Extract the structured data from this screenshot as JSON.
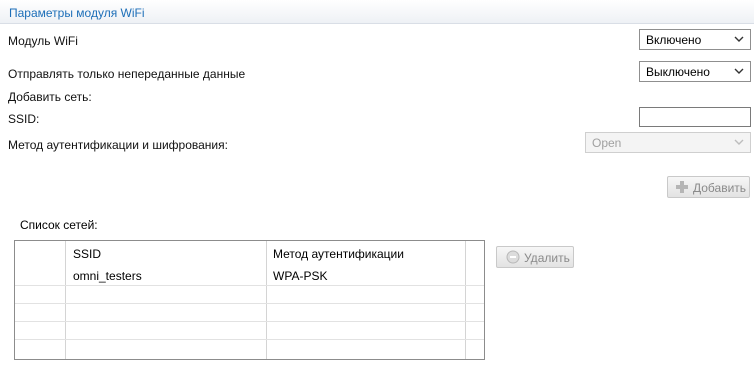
{
  "panel": {
    "title": "Параметры модуля WiFi"
  },
  "wifi_module": {
    "label": "Модуль WiFi",
    "value": "Включено"
  },
  "send_only": {
    "label": "Отправлять только непереданные данные",
    "value": "Выключено"
  },
  "add_network": {
    "label": "Добавить сеть:"
  },
  "ssid": {
    "label": "SSID:",
    "value": ""
  },
  "auth_method": {
    "label": "Метод аутентификации и шифрования:",
    "value": "Open"
  },
  "add_button": {
    "label": "Добавить"
  },
  "networks": {
    "label": "Список сетей:",
    "columns": [
      "SSID",
      "Метод аутентификации"
    ],
    "rows": [
      {
        "ssid": "omni_testers",
        "auth": "WPA-PSK"
      }
    ]
  },
  "delete_button": {
    "label": "Удалить"
  },
  "colors": {
    "title": "#1d6fb8",
    "disabled_text": "#8a8a8a"
  }
}
